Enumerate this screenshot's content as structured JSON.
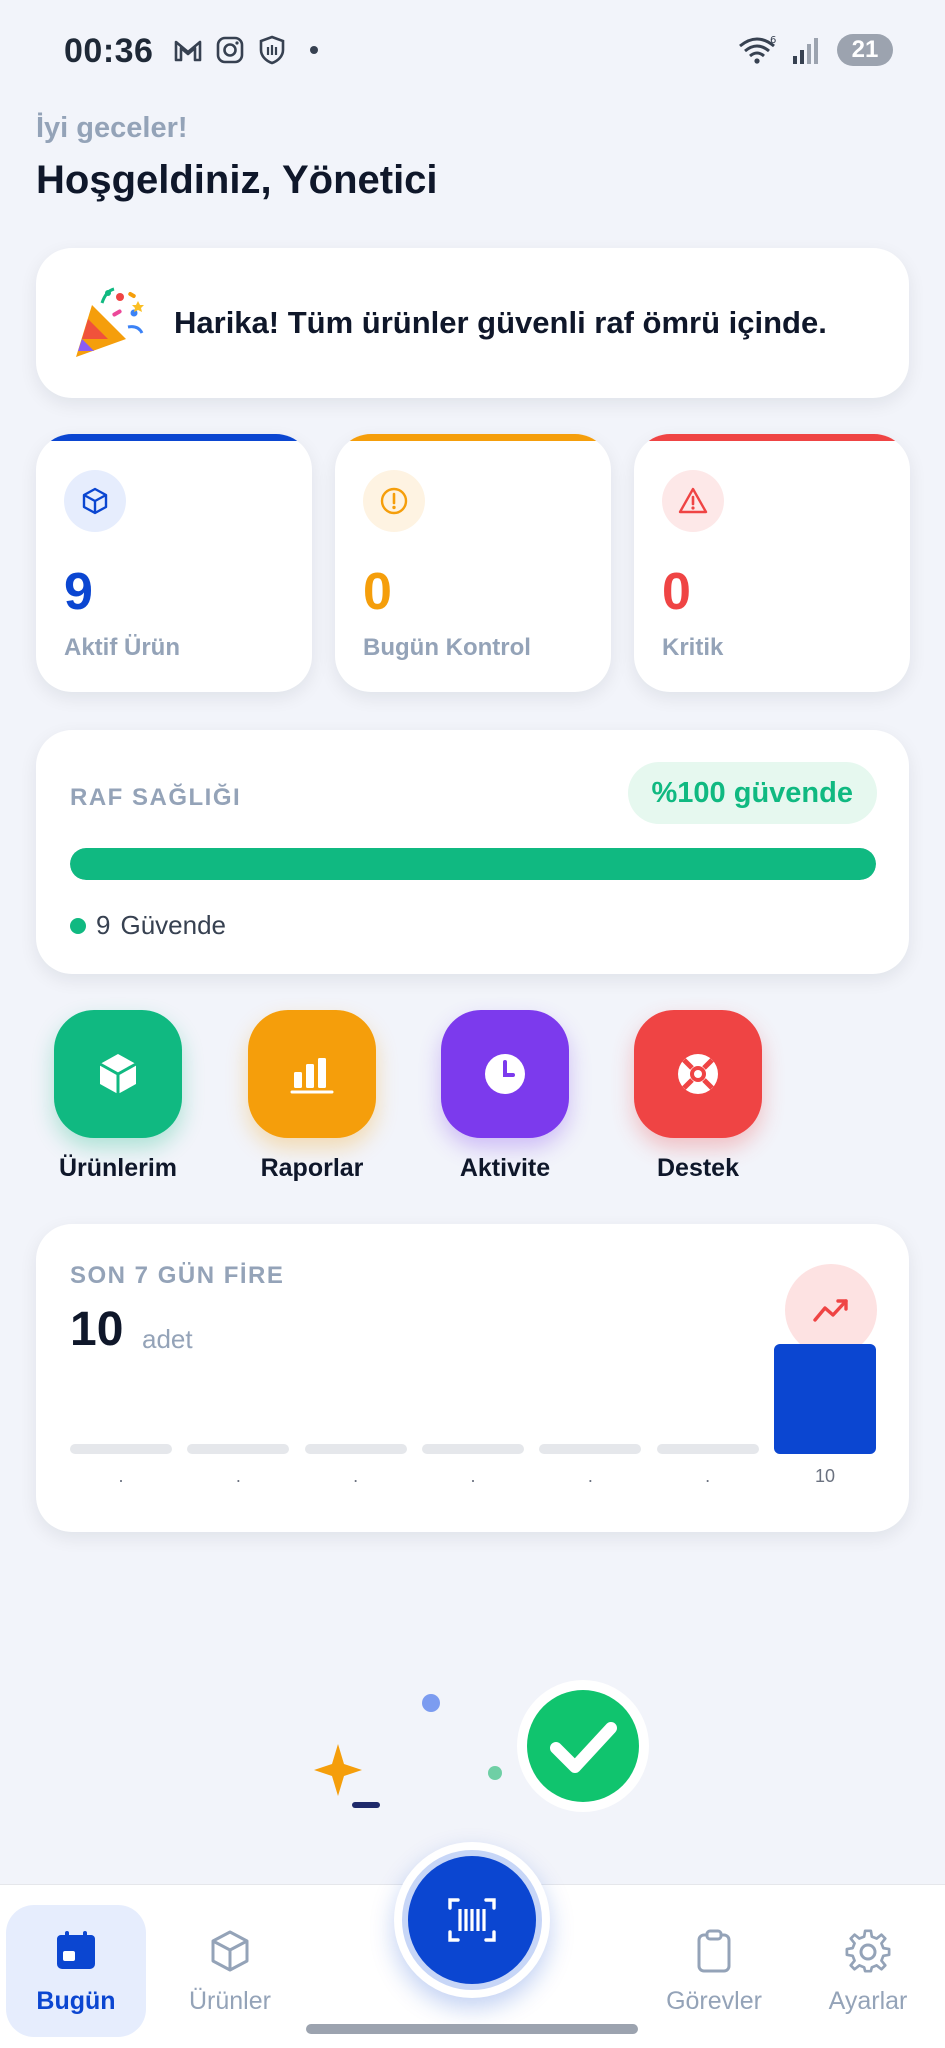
{
  "status": {
    "time": "00:36",
    "battery": "21",
    "signal_label": "6"
  },
  "greeting": {
    "small": "İyi geceler!",
    "title": "Hoşgeldiniz, Yönetici"
  },
  "banner": {
    "emoji": "party-popper-icon",
    "text": "Harika! Tüm ürünler güvenli raf ömrü içinde."
  },
  "stats": [
    {
      "value": "9",
      "label": "Aktif Ürün",
      "color": "#0b46d1",
      "icon": "cube-icon"
    },
    {
      "value": "0",
      "label": "Bugün Kontrol",
      "color": "#f59e0b",
      "icon": "alert-circle-icon"
    },
    {
      "value": "0",
      "label": "Kritik",
      "color": "#ef4444",
      "icon": "warning-triangle-icon"
    }
  ],
  "health": {
    "title": "RAF SAĞLIĞI",
    "pill": "%100 güvende",
    "fill_fraction": 1.0,
    "legend_count": "9",
    "legend_label": "Güvende",
    "color": "#10b981"
  },
  "actions": [
    {
      "label": "Ürünlerim",
      "color": "#10b981",
      "icon": "cube-icon"
    },
    {
      "label": "Raporlar",
      "color": "#f59e0b",
      "icon": "bar-chart-icon"
    },
    {
      "label": "Aktivite",
      "color": "#7c3aed",
      "icon": "clock-icon"
    },
    {
      "label": "Destek",
      "color": "#ef4444",
      "icon": "lifebuoy-icon"
    }
  ],
  "fire": {
    "title": "SON 7 GÜN FİRE",
    "value": "10",
    "unit": "adet",
    "trend_icon": "trending-up-icon"
  },
  "chart_data": {
    "type": "bar",
    "categories": [
      "",
      "",
      "",
      "",
      "",
      "",
      ""
    ],
    "values": [
      0,
      0,
      0,
      0,
      0,
      0,
      10
    ],
    "tick_labels": [
      ".",
      ".",
      ".",
      ".",
      ".",
      ".",
      "10"
    ],
    "ylim": [
      0,
      10
    ],
    "title": "SON 7 GÜN FİRE"
  },
  "nav": {
    "items": [
      {
        "label": "Bugün",
        "icon": "calendar-icon",
        "active": true
      },
      {
        "label": "Ürünler",
        "icon": "cube-icon",
        "active": false
      },
      {
        "label": "Görevler",
        "icon": "clipboard-icon",
        "active": false
      },
      {
        "label": "Ayarlar",
        "icon": "gear-icon",
        "active": false
      }
    ],
    "fab_icon": "barcode-scan-icon"
  }
}
